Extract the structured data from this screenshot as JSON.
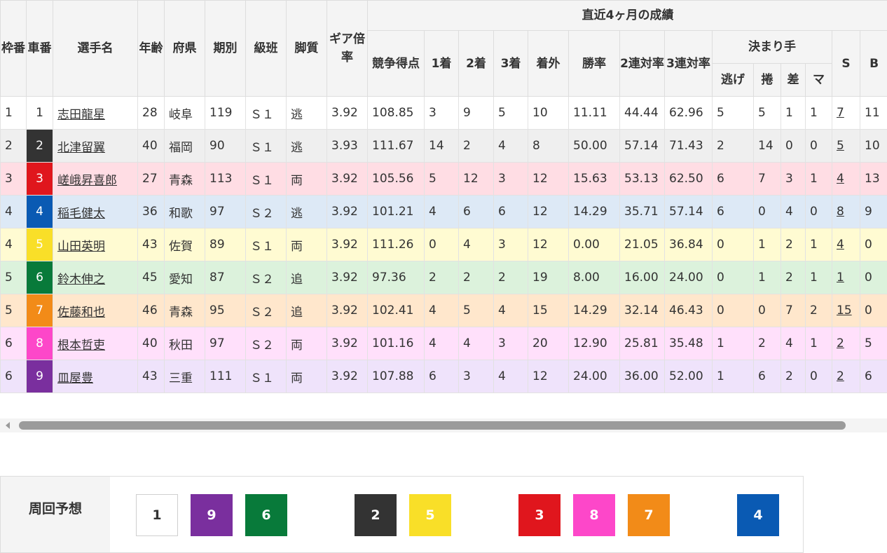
{
  "header": {
    "waku": "枠番",
    "sha": "車番",
    "name": "選手名",
    "age": "年齢",
    "pref": "府県",
    "term": "期別",
    "class": "級班",
    "style": "脚質",
    "gear": "ギア倍率",
    "recent": "直近4ヶ月の成績",
    "score": "競争得点",
    "first": "1着",
    "second": "2着",
    "third": "3着",
    "out": "着外",
    "win_rate": "勝率",
    "quinella_rate": "2連対率",
    "trio_rate": "3連対率",
    "kimarite": "決まり手",
    "nige": "逃げ",
    "makuri": "捲",
    "sashi": "差",
    "mark": "マ",
    "s": "S",
    "b": "B"
  },
  "riders": [
    {
      "waku": "1",
      "sha": "1",
      "name": "志田龍星",
      "age": "28",
      "pref": "岐阜",
      "term": "119",
      "class": "Ｓ１",
      "style": "逃",
      "gear": "3.92",
      "score": "108.85",
      "first": "3",
      "second": "9",
      "third": "5",
      "out": "10",
      "win": "11.11",
      "quinella": "44.44",
      "trio": "62.96",
      "nige": "5",
      "makuri": "5",
      "sashi": "1",
      "mark": "1",
      "s": "7",
      "b": "11"
    },
    {
      "waku": "2",
      "sha": "2",
      "name": "北津留翼",
      "age": "40",
      "pref": "福岡",
      "term": "90",
      "class": "Ｓ１",
      "style": "逃",
      "gear": "3.93",
      "score": "111.67",
      "first": "14",
      "second": "2",
      "third": "4",
      "out": "8",
      "win": "50.00",
      "quinella": "57.14",
      "trio": "71.43",
      "nige": "2",
      "makuri": "14",
      "sashi": "0",
      "mark": "0",
      "s": "5",
      "b": "10"
    },
    {
      "waku": "3",
      "sha": "3",
      "name": "嵯峨昇喜郎",
      "age": "27",
      "pref": "青森",
      "term": "113",
      "class": "Ｓ１",
      "style": "両",
      "gear": "3.92",
      "score": "105.56",
      "first": "5",
      "second": "12",
      "third": "3",
      "out": "12",
      "win": "15.63",
      "quinella": "53.13",
      "trio": "62.50",
      "nige": "6",
      "makuri": "7",
      "sashi": "3",
      "mark": "1",
      "s": "4",
      "b": "13"
    },
    {
      "waku": "4",
      "sha": "4",
      "name": "稲毛健太",
      "age": "36",
      "pref": "和歌",
      "term": "97",
      "class": "Ｓ２",
      "style": "逃",
      "gear": "3.92",
      "score": "101.21",
      "first": "4",
      "second": "6",
      "third": "6",
      "out": "12",
      "win": "14.29",
      "quinella": "35.71",
      "trio": "57.14",
      "nige": "6",
      "makuri": "0",
      "sashi": "4",
      "mark": "0",
      "s": "8",
      "b": "9"
    },
    {
      "waku": "4",
      "sha": "5",
      "name": "山田英明",
      "age": "43",
      "pref": "佐賀",
      "term": "89",
      "class": "Ｓ１",
      "style": "両",
      "gear": "3.92",
      "score": "111.26",
      "first": "0",
      "second": "4",
      "third": "3",
      "out": "12",
      "win": "0.00",
      "quinella": "21.05",
      "trio": "36.84",
      "nige": "0",
      "makuri": "1",
      "sashi": "2",
      "mark": "1",
      "s": "4",
      "b": "0"
    },
    {
      "waku": "5",
      "sha": "6",
      "name": "鈴木伸之",
      "age": "45",
      "pref": "愛知",
      "term": "87",
      "class": "Ｓ２",
      "style": "追",
      "gear": "3.92",
      "score": "97.36",
      "first": "2",
      "second": "2",
      "third": "2",
      "out": "19",
      "win": "8.00",
      "quinella": "16.00",
      "trio": "24.00",
      "nige": "0",
      "makuri": "1",
      "sashi": "2",
      "mark": "1",
      "s": "1",
      "b": "0"
    },
    {
      "waku": "5",
      "sha": "7",
      "name": "佐藤和也",
      "age": "46",
      "pref": "青森",
      "term": "95",
      "class": "Ｓ２",
      "style": "追",
      "gear": "3.92",
      "score": "102.41",
      "first": "4",
      "second": "5",
      "third": "4",
      "out": "15",
      "win": "14.29",
      "quinella": "32.14",
      "trio": "46.43",
      "nige": "0",
      "makuri": "0",
      "sashi": "7",
      "mark": "2",
      "s": "15",
      "b": "0"
    },
    {
      "waku": "6",
      "sha": "8",
      "name": "根本哲吏",
      "age": "40",
      "pref": "秋田",
      "term": "97",
      "class": "Ｓ２",
      "style": "両",
      "gear": "3.92",
      "score": "101.16",
      "first": "4",
      "second": "4",
      "third": "3",
      "out": "20",
      "win": "12.90",
      "quinella": "25.81",
      "trio": "35.48",
      "nige": "1",
      "makuri": "2",
      "sashi": "4",
      "mark": "1",
      "s": "2",
      "b": "5"
    },
    {
      "waku": "6",
      "sha": "9",
      "name": "皿屋豊",
      "age": "43",
      "pref": "三重",
      "term": "111",
      "class": "Ｓ１",
      "style": "両",
      "gear": "3.92",
      "score": "107.88",
      "first": "6",
      "second": "3",
      "third": "4",
      "out": "12",
      "win": "24.00",
      "quinella": "36.00",
      "trio": "52.00",
      "nige": "1",
      "makuri": "6",
      "sashi": "2",
      "mark": "0",
      "s": "2",
      "b": "6"
    }
  ],
  "bike_colors": {
    "1": "#ffffff",
    "2": "#333333",
    "3": "#e0161d",
    "4": "#0a5ab3",
    "5": "#f9df28",
    "6": "#087a3a",
    "7": "#f28b18",
    "8": "#fd47c9",
    "9": "#7a2f9e"
  },
  "prediction": {
    "label": "周回予想",
    "lineup": [
      "1",
      "9",
      "6",
      "2",
      "5",
      "3",
      "8",
      "7",
      "4"
    ]
  }
}
